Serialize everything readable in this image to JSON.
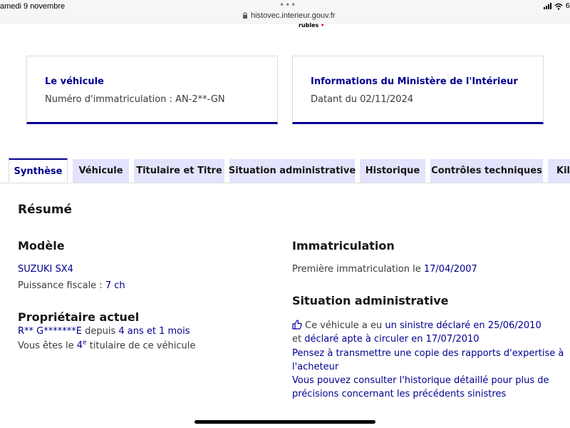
{
  "status_bar": {
    "date": "amedi 9 novembre",
    "url": "histovec.interieur.gouv.fr",
    "battery_partial": "6"
  },
  "header_remnant": {
    "text": "rubles",
    "flag": "•"
  },
  "vehicle_card": {
    "title": "Le véhicule",
    "registration_label": "Numéro d'immatriculation : AN-2**-GN"
  },
  "ministry_card": {
    "title": "Informations du Ministère de l'Intérieur",
    "date_text": "Datant du 02/11/2024"
  },
  "tabs": [
    {
      "label": "Synthèse",
      "active": true
    },
    {
      "label": "Véhicule",
      "active": false
    },
    {
      "label": "Titulaire et Titre",
      "active": false
    },
    {
      "label": "Situation administrative",
      "active": false
    },
    {
      "label": "Historique",
      "active": false
    },
    {
      "label": "Contrôles techniques",
      "active": false
    },
    {
      "label": "Kilo",
      "active": false
    }
  ],
  "summary": {
    "title": "Résumé",
    "model": {
      "heading": "Modèle",
      "name": "SUZUKI SX4",
      "power_label": "Puissance fiscale :",
      "power_value": "7 ch"
    },
    "owner": {
      "heading": "Propriétaire actuel",
      "name": "R** G*******E",
      "since_label": "depuis",
      "since_value": "4 ans et 1 mois",
      "holder_prefix": "Vous êtes le",
      "holder_rank": "4",
      "holder_sup": "e",
      "holder_suffix": "titulaire de ce véhicule"
    },
    "registration": {
      "heading": "Immatriculation",
      "first_label": "Première immatriculation le",
      "first_date": "17/04/2007"
    },
    "admin": {
      "heading": "Situation administrative",
      "claim_prefix": "Ce véhicule a eu",
      "claim_link": "un sinistre déclaré en 25/06/2010",
      "fit_prefix": "et",
      "fit_link": "déclaré apte à circuler en 17/07/2010",
      "advice_line1": "Pensez à transmettre une copie des rapports d'expertise à",
      "advice_line2": "l'acheteur",
      "history_line1": "Vous pouvez consulter l'historique détaillé pour plus de",
      "history_line2": "précisions concernant les précédents sinistres"
    }
  },
  "colors": {
    "accent": "#000091",
    "tab_bg": "#e3e3fd",
    "text": "#161616",
    "muted": "#3a3a3a"
  }
}
